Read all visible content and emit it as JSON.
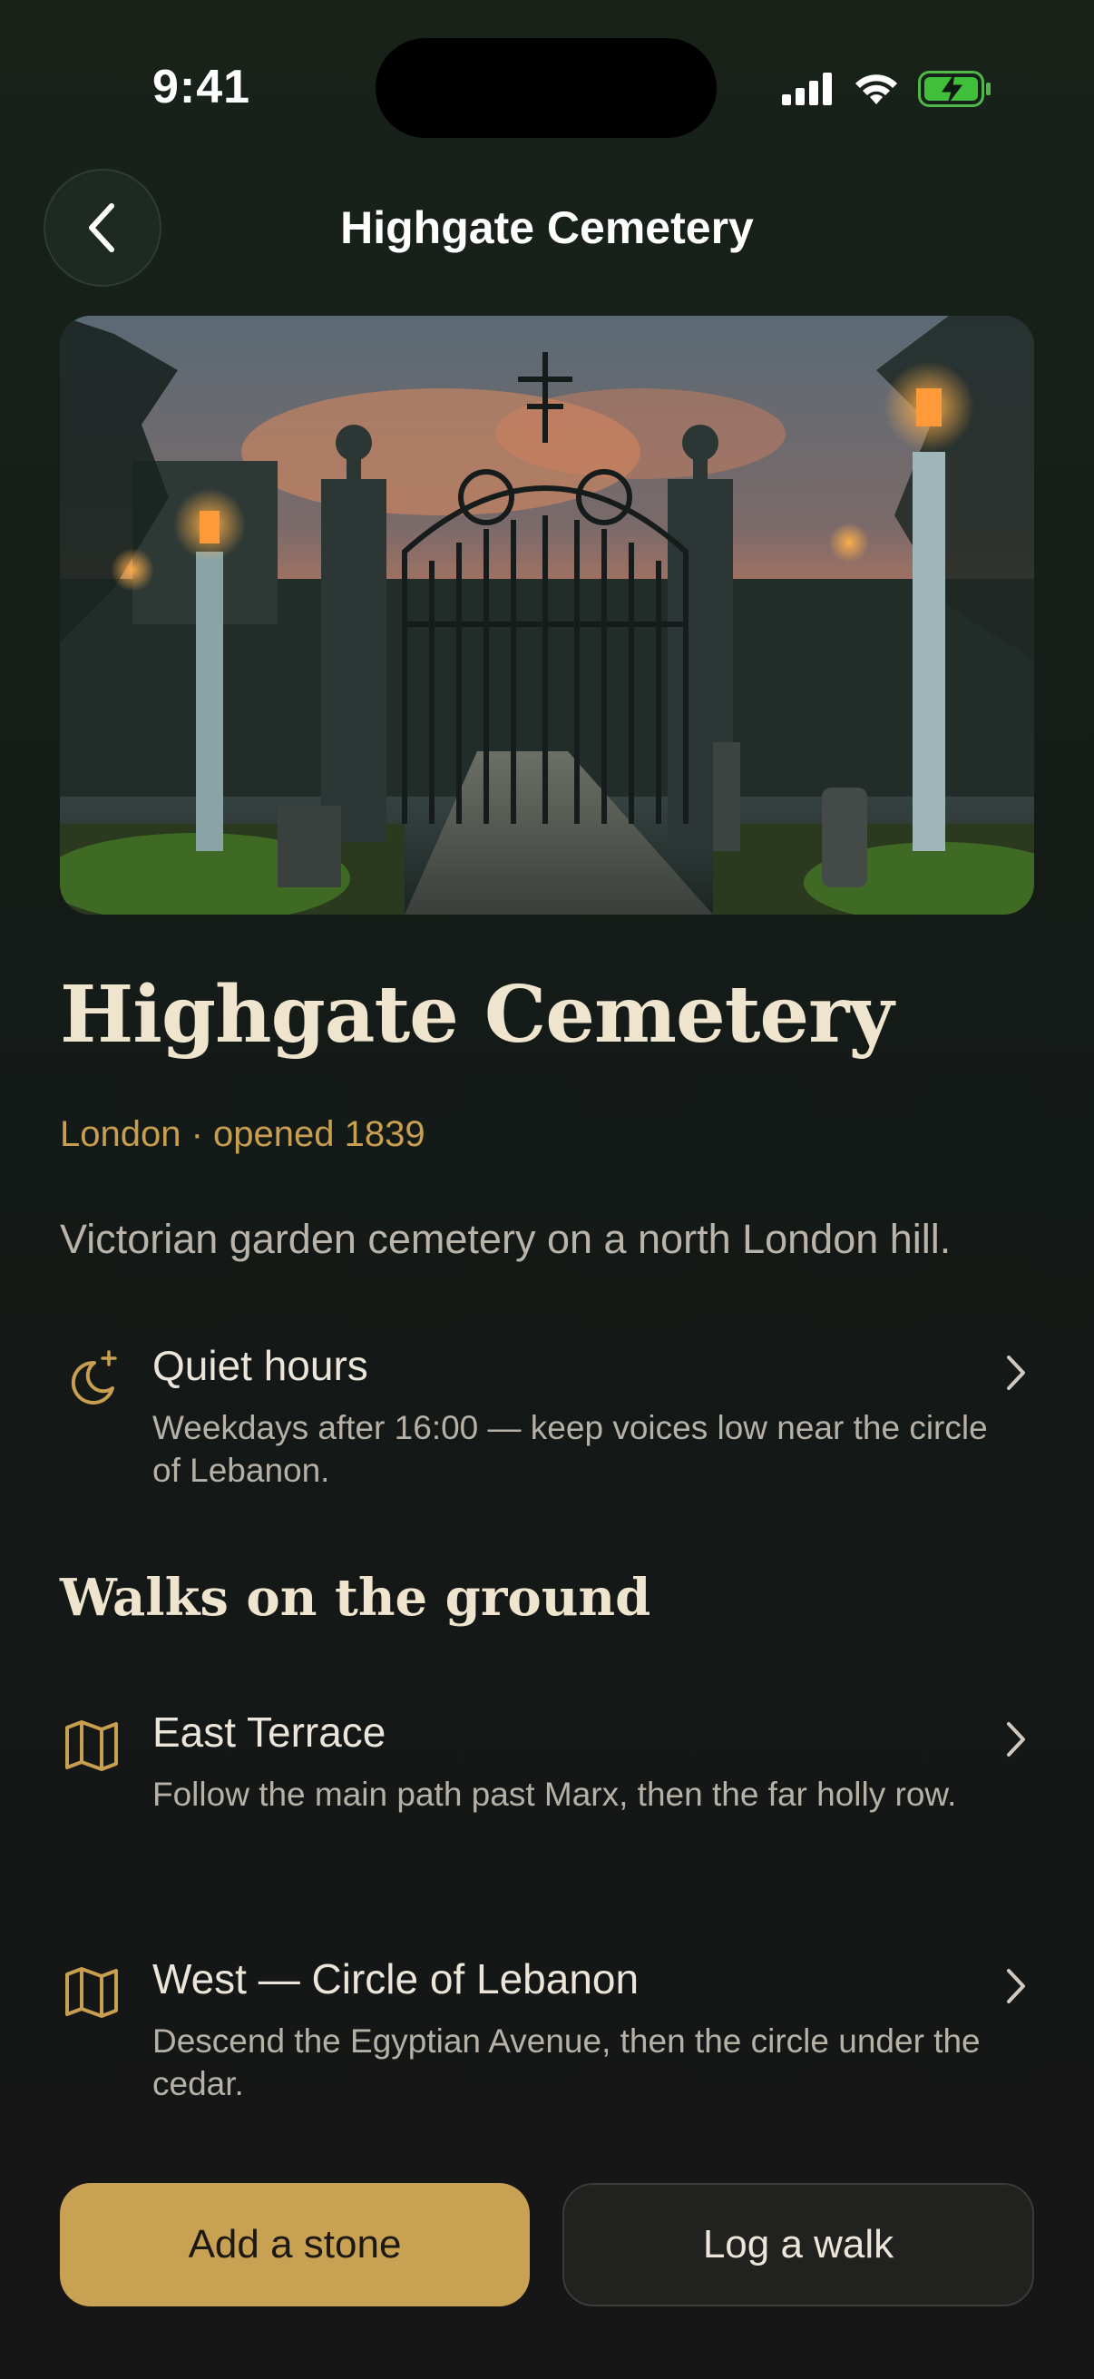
{
  "status_bar": {
    "time": "9:41"
  },
  "nav": {
    "title": "Highgate Cemetery",
    "back_icon": "chevron-left-icon"
  },
  "hero": {
    "alt": "Ornate iron gates of a cemetery at dusk with lanterns"
  },
  "place": {
    "title": "Highgate Cemetery",
    "subtitle": "London · opened 1839",
    "description": "Victorian garden cemetery on a north London hill."
  },
  "quiet_hours": {
    "icon": "moon-sparkle-icon",
    "title": "Quiet hours",
    "text": "Weekdays after 16:00 — keep voices low near the circle of Lebanon."
  },
  "walks": {
    "heading": "Walks on the ground",
    "items": [
      {
        "icon": "map-icon",
        "title": "East Terrace",
        "text": "Follow the main path past Marx, then the far holly row."
      },
      {
        "icon": "map-icon",
        "title": "West — Circle of Lebanon",
        "text": "Descend the Egyptian Avenue, then the circle under the cedar."
      }
    ]
  },
  "actions": {
    "primary": "Add a stone",
    "secondary": "Log a walk"
  },
  "colors": {
    "accent": "#c9a153",
    "background": "#151c18",
    "title": "#efe5cf"
  }
}
